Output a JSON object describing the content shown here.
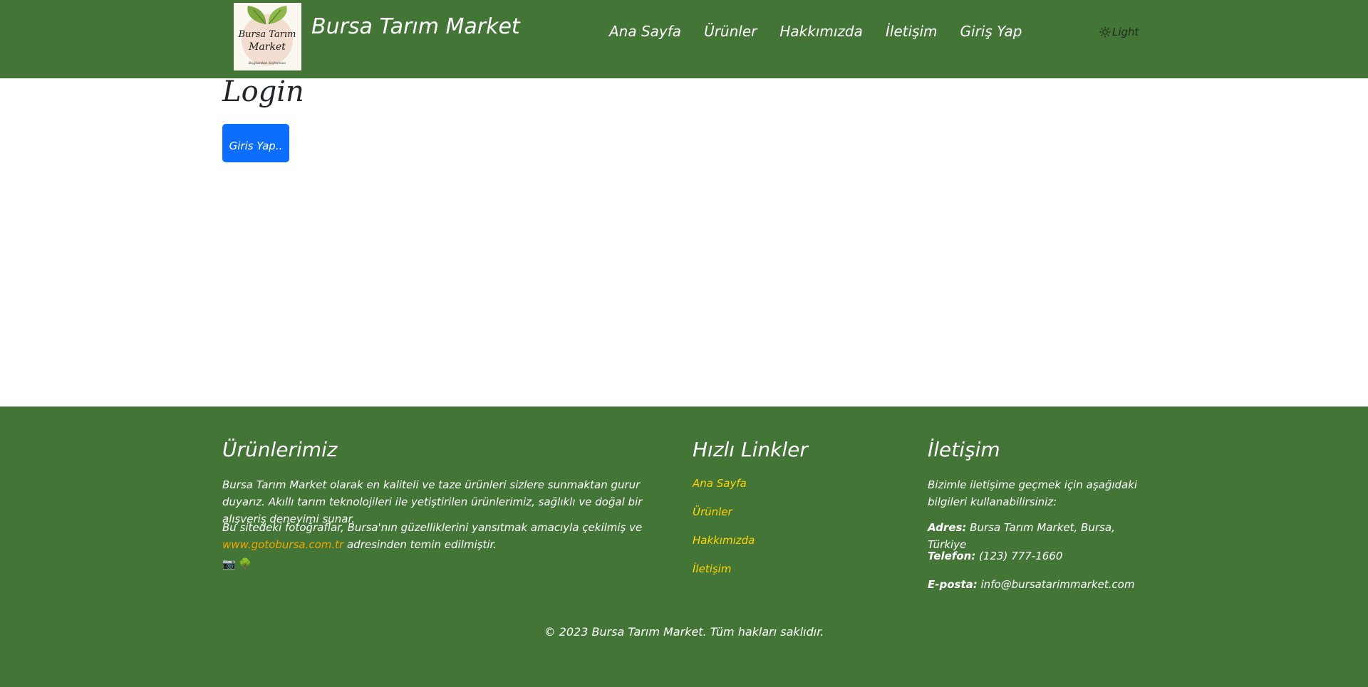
{
  "header": {
    "logo_text_line1": "Bursa Tarım",
    "logo_text_line2": "Market",
    "logo_tagline": "Bağlardan Sofranıza",
    "brand": "Bursa Tarım Market",
    "nav": [
      "Ana Sayfa",
      "Ürünler",
      "Hakkımızda",
      "İletişim",
      "Giriş Yap"
    ],
    "theme_label": "Light",
    "theme_icon": "sun-icon"
  },
  "main": {
    "title": "Login",
    "login_button": "Giris Yap.."
  },
  "footer": {
    "products": {
      "title": "Ürünlerimiz",
      "paragraph1": "Bursa Tarım Market olarak en kaliteli ve taze ürünleri sizlere sunmaktan gurur duyarız. Akıllı tarım teknolojileri ile yetiştirilen ürünlerimiz, sağlıklı ve doğal bir alışveriş deneyimi sunar.",
      "paragraph2_before": "Bu sitedeki fotoğraflar, Bursa'nın güzelliklerini yansıtmak amacıyla çekilmiş ve",
      "paragraph2_link": "www.gotobursa.com.tr",
      "paragraph2_after": "adresinden temin edilmiştir.",
      "icons": [
        "📷",
        "🌳"
      ]
    },
    "quick_links": {
      "title": "Hızlı Linkler",
      "items": [
        "Ana Sayfa",
        "Ürünler",
        "Hakkımızda",
        "İletişim"
      ]
    },
    "contact": {
      "title": "İletişim",
      "intro": "Bizimle iletişime geçmek için aşağıdaki bilgileri kullanabilirsiniz:",
      "address_label": "Adres:",
      "address_value": "Bursa Tarım Market, Bursa, Türkiye",
      "phone_label": "Telefon:",
      "phone_value": "(123) 777-1660",
      "email_label": "E-posta:",
      "email_value": "info@bursatarimmarket.com"
    },
    "copyright": "© 2023 Bursa Tarım Market. Tüm hakları saklıdır."
  },
  "colors": {
    "header_bg": "#437537",
    "footer_bg": "#437537",
    "primary_button": "#0d6efd",
    "quick_link": "#ffd400",
    "external_link": "#f0a500"
  }
}
